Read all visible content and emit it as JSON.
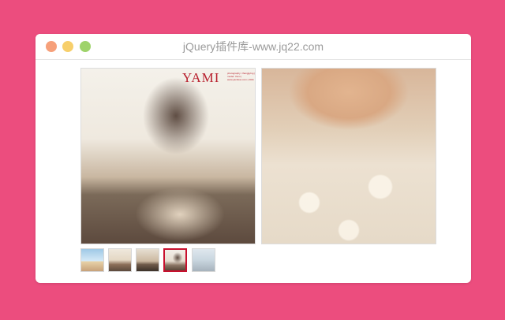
{
  "window": {
    "title": "jQuery插件库-www.jq22.com"
  },
  "main_image": {
    "brand": "YAMI",
    "brand_caption": "photography: zhangjiying | model: Yami | www.yamikuo.com | 2011"
  },
  "thumbnails": [
    {
      "name": "thumb-1",
      "active": false
    },
    {
      "name": "thumb-2",
      "active": false
    },
    {
      "name": "thumb-3",
      "active": false
    },
    {
      "name": "thumb-4",
      "active": true
    },
    {
      "name": "thumb-5",
      "active": false
    }
  ],
  "colors": {
    "page_background": "#ec4d7e",
    "window_background": "#ffffff",
    "traffic_light_red": "#f6a07a",
    "traffic_light_yellow": "#f7cf6b",
    "traffic_light_green": "#9ed36a",
    "active_thumb_border": "#c8102e",
    "brand_text": "#b8202e"
  }
}
